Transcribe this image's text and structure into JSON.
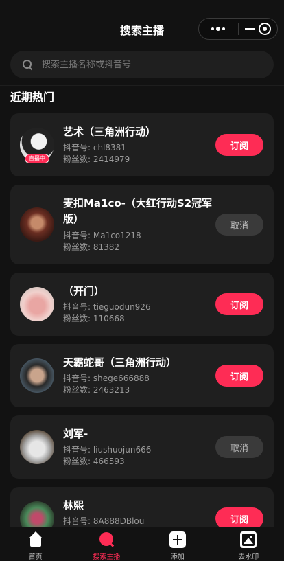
{
  "header": {
    "title": "搜索主播",
    "capsule": {
      "more_icon": "more-dots-icon",
      "minimize_icon": "minus-icon",
      "close_icon": "target-icon"
    }
  },
  "search": {
    "placeholder": "搜索主播名称或抖音号",
    "value": ""
  },
  "section": {
    "title": "近期热门"
  },
  "streamers": [
    {
      "name": "艺术（三角洲行动）",
      "douyin": "抖音号: chl8381",
      "fans": "粉丝数: 2414979",
      "live": "直播中",
      "button": "订阅",
      "subscribed": false
    },
    {
      "name": "麦扣Ma1co-（大红行动S2冠军版）",
      "douyin": "抖音号: Ma1co1218",
      "fans": "粉丝数: 81382",
      "live": "",
      "button": "取消",
      "subscribed": true
    },
    {
      "name": "（开门）",
      "douyin": "抖音号: tieguodun926",
      "fans": "粉丝数: 110668",
      "live": "",
      "button": "订阅",
      "subscribed": false
    },
    {
      "name": "天霸蛇哥（三角洲行动）",
      "douyin": "抖音号: shege666888",
      "fans": "粉丝数: 2463213",
      "live": "",
      "button": "订阅",
      "subscribed": false
    },
    {
      "name": "刘军-",
      "douyin": "抖音号: liushuojun666",
      "fans": "粉丝数: 466593",
      "live": "",
      "button": "取消",
      "subscribed": true
    },
    {
      "name": "林熙",
      "douyin": "抖音号: 8A888DBlou",
      "fans": "",
      "live": "",
      "button": "订阅",
      "subscribed": false
    }
  ],
  "tabbar": {
    "items": [
      {
        "label": "首页",
        "icon": "home-icon",
        "active": false
      },
      {
        "label": "搜索主播",
        "icon": "search-icon",
        "active": true
      },
      {
        "label": "添加",
        "icon": "add-icon",
        "active": false
      },
      {
        "label": "去水印",
        "icon": "image-icon",
        "active": false
      }
    ]
  },
  "colors": {
    "accent": "#fe2c55",
    "background": "#121212",
    "card": "#1f1f1f"
  }
}
